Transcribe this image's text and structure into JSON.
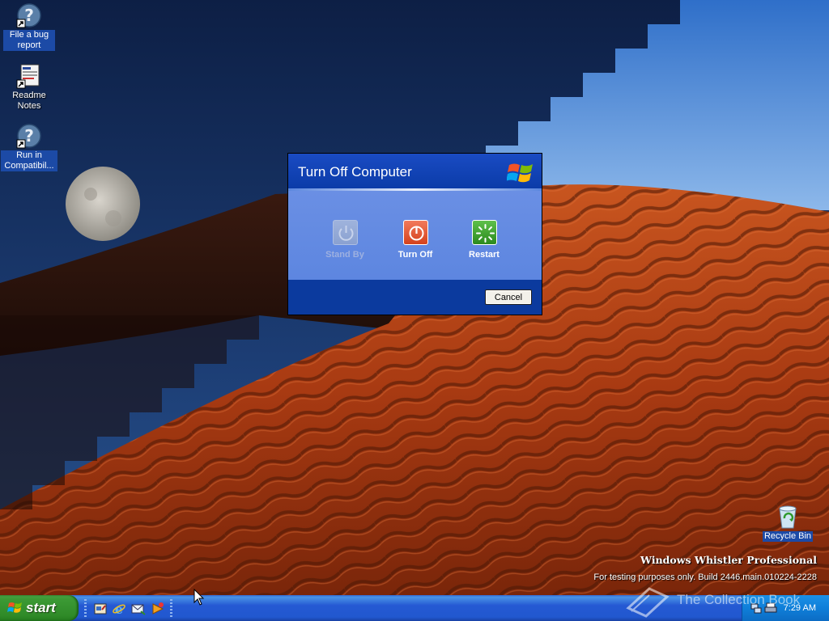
{
  "desktop": {
    "icons": [
      {
        "label": "File a bug report",
        "icon": "help-shortcut-icon"
      },
      {
        "label": "Readme Notes",
        "icon": "notes-shortcut-icon"
      },
      {
        "label": "Run in Compatibil...",
        "icon": "help-shortcut-icon"
      },
      {
        "label": "Recycle Bin",
        "icon": "recycle-bin-icon"
      }
    ],
    "watermark_title": "Windows Whistler Professional",
    "watermark_build": "For testing purposes only. Build 2446.main.010224-2228",
    "collection_mark": "The Collection Book"
  },
  "dialog": {
    "title": "Turn Off Computer",
    "options": [
      {
        "label": "Stand By",
        "icon": "standby-icon",
        "enabled": false
      },
      {
        "label": "Turn Off",
        "icon": "power-icon",
        "enabled": true
      },
      {
        "label": "Restart",
        "icon": "restart-icon",
        "enabled": true
      }
    ],
    "cancel_label": "Cancel"
  },
  "taskbar": {
    "start_label": "start",
    "quick_launch": [
      "show-desktop-icon",
      "internet-explorer-icon",
      "outlook-express-icon",
      "media-player-icon"
    ],
    "clock": "7:29 AM"
  },
  "colors": {
    "dialog_blue": "#0b3a9e",
    "dialog_body": "#6a8fe4",
    "start_green": "#3c9a35",
    "taskbar_blue": "#2559d3"
  }
}
